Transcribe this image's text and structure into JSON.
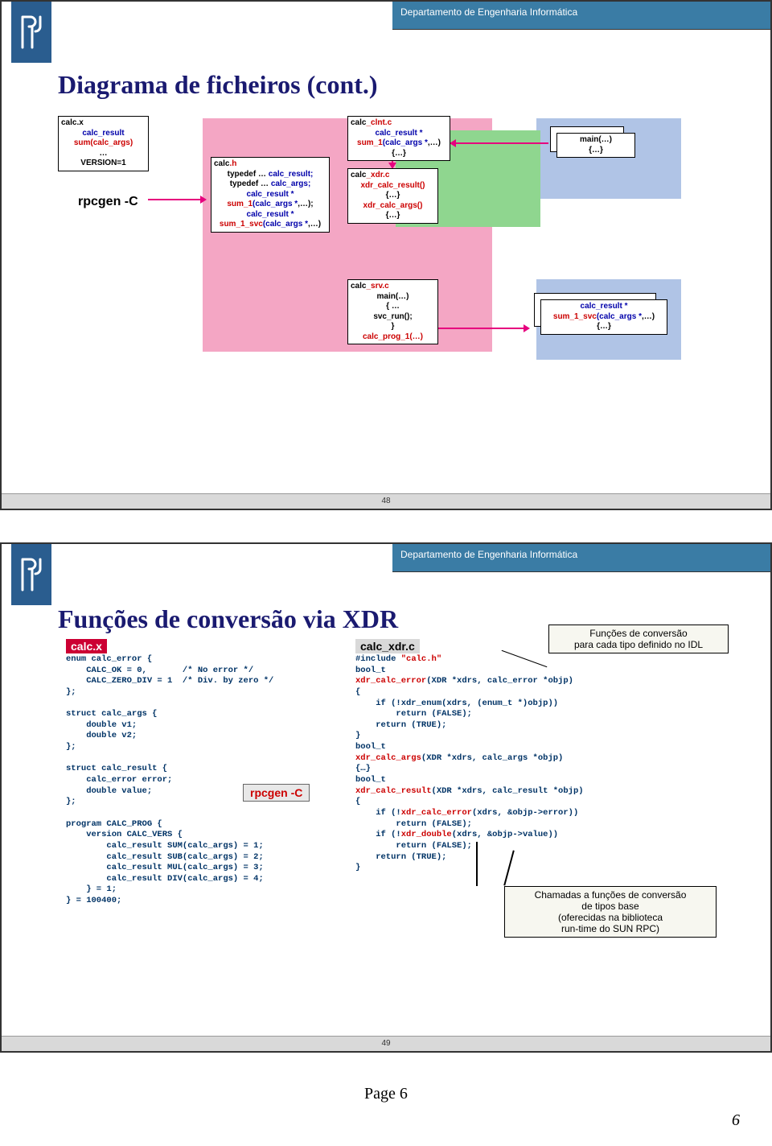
{
  "dept": "Departamento de Engenharia Informática",
  "slide1": {
    "number": "48",
    "title": "Diagrama de ficheiros (cont.)",
    "rpcgen_label": "rpcgen -C",
    "boxes": {
      "calcx": {
        "title": "calc.x",
        "l1": "calc_result",
        "l2": "sum(calc_args)",
        "l3": "…",
        "l4": "VERSION=1"
      },
      "calch": {
        "title": "calc.h",
        "l1": "typedef … calc_result;",
        "l2": "typedef … calc_args;",
        "l3": "calc_result *",
        "l4": "sum_1(calc_args *,…);",
        "l5": "calc_result *",
        "l6": "sum_1_svc(calc_args *,…)"
      },
      "clnt": {
        "title": "calc_clnt.c",
        "l1": "calc_result *",
        "l2": "sum_1(calc_args *,…)",
        "l3": "{…}"
      },
      "xdr": {
        "title": "calc_xdr.c",
        "l1": "xdr_calc_result()",
        "l2": "{…}",
        "l3": "xdr_calc_args()",
        "l4": "{…}"
      },
      "srv": {
        "title": "calc_srv.c",
        "l1": "main(…)",
        "l2": "{ …",
        "l3": "svc_run();",
        "l4": "}",
        "l5": "calc_prog_1(…)"
      },
      "mainclient": {
        "l1": "main(…)",
        "l2": "{…}"
      },
      "serverimpl": {
        "l1": "calc_result *",
        "l2": "sum_1_svc(calc_args *,…)",
        "l3": "{…}"
      }
    }
  },
  "slide2": {
    "number": "49",
    "title": "Funções de conversão via XDR",
    "calcx_title": "calc.x",
    "calcx_code": "enum calc_error {\n    CALC_OK = 0,       /* No error */\n    CALC_ZERO_DIV = 1  /* Div. by zero */\n};\n\nstruct calc_args {\n    double v1;\n    double v2;\n};\n\nstruct calc_result {\n    calc_error error;\n    double value;\n};\n\nprogram CALC_PROG {\n    version CALC_VERS {\n        calc_result SUM(calc_args) = 1;\n        calc_result SUB(calc_args) = 2;\n        calc_result MUL(calc_args) = 3;\n        calc_result DIV(calc_args) = 4;\n    } = 1;\n} = 100400;",
    "xdrc_title": "calc_xdr.c",
    "xdrc_code": "#include \"calc.h\"\nbool_t\nxdr_calc_error(XDR *xdrs, calc_error *objp)\n{\n    if (!xdr_enum(xdrs, (enum_t *)objp))\n        return (FALSE);\n    return (TRUE);\n}\nbool_t\nxdr_calc_args(XDR *xdrs, calc_args *objp)\n{…}\nbool_t\nxdr_calc_result(XDR *xdrs, calc_result *objp)\n{\n    if (!xdr_calc_error(xdrs, &objp->error))\n        return (FALSE);\n    if (!xdr_double(xdrs, &objp->value))\n        return (FALSE);\n    return (TRUE);\n}",
    "rpcgen_label": "rpcgen -C",
    "callout1": "Funções de conversão\npara cada tipo definido no IDL",
    "callout2": "Chamadas a funções de conversão\nde tipos base\n(oferecidas na biblioteca\nrun-time do SUN RPC)"
  },
  "page_footer": "Page 6",
  "page_num_italic": "6"
}
